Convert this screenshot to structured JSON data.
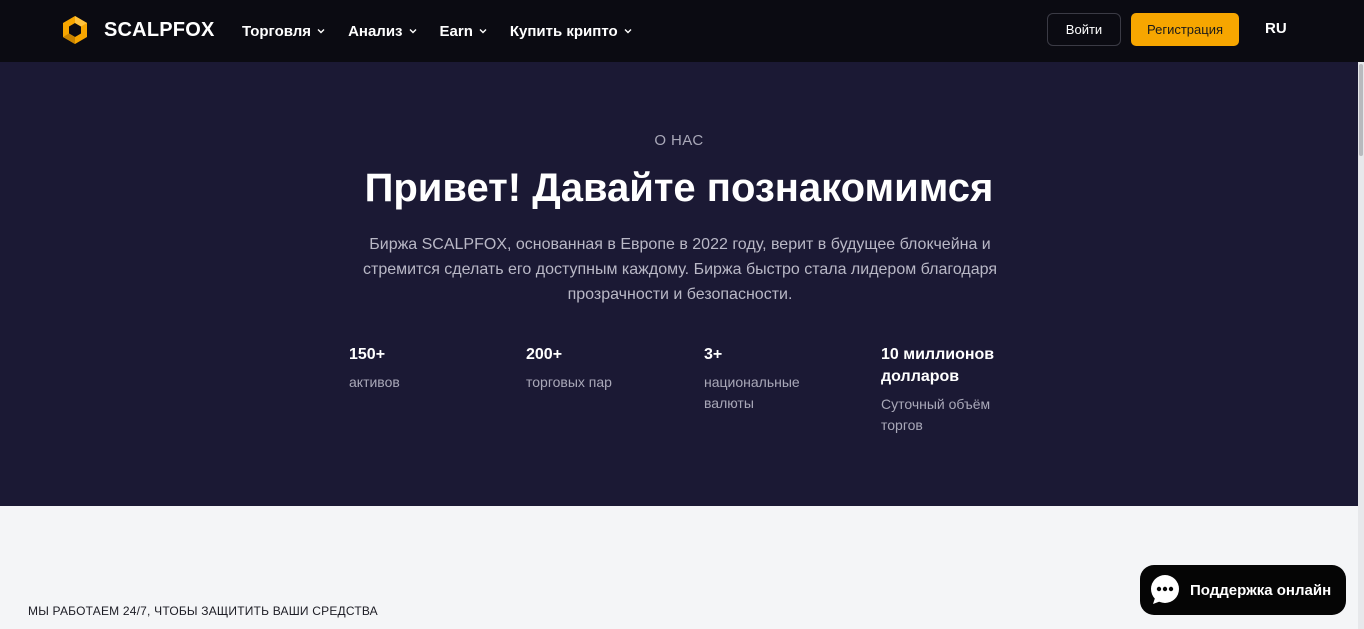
{
  "header": {
    "brand": "SCALPFOX",
    "nav": [
      {
        "label": "Торговля"
      },
      {
        "label": "Анализ"
      },
      {
        "label": "Earn"
      },
      {
        "label": "Купить крипто"
      }
    ],
    "login_label": "Войти",
    "register_label": "Регистрация",
    "language": "RU"
  },
  "hero": {
    "eyebrow": "О НАС",
    "title": "Привет! Давайте познакомимся",
    "description": "Биржа SCALPFOX, основанная в Европе в 2022 году, верит в будущее блокчейна и стремится сделать его доступным каждому. Биржа быстро стала лидером благодаря прозрачности и безопасности.",
    "stats": [
      {
        "value": "150+",
        "label": "активов"
      },
      {
        "value": "200+",
        "label": "торговых пар"
      },
      {
        "value": "3+",
        "label": "национальные валюты"
      },
      {
        "value": "10 миллионов долларов",
        "label": "Суточный объём торгов"
      }
    ]
  },
  "section": {
    "label": "МЫ РАБОТАЕМ 24/7, ЧТОБЫ ЗАЩИТИТЬ ВАШИ СРЕДСТВА"
  },
  "support": {
    "label": "Поддержка онлайн"
  },
  "colors": {
    "header_bg": "#0b0b12",
    "hero_bg": "#1b1934",
    "accent": "#f7a600",
    "page_bg": "#f4f5f7"
  },
  "icons": [
    "logo-hexagon-icon",
    "chevron-down-icon",
    "chat-bubble-icon"
  ]
}
